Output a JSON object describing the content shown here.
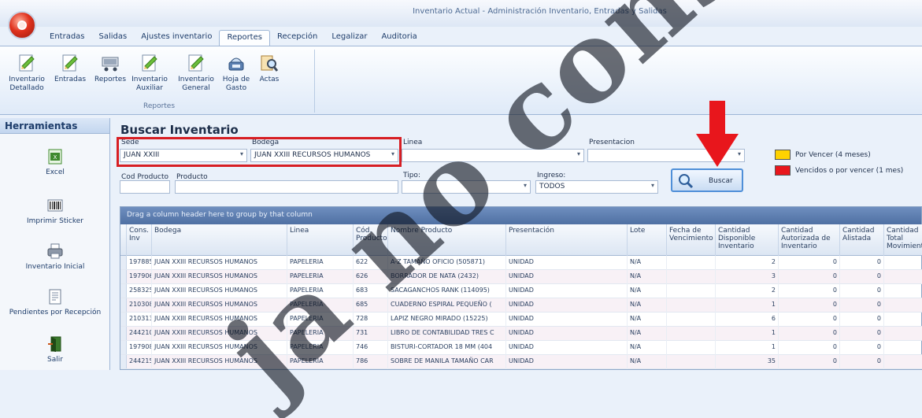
{
  "window": {
    "title": "Inventario Actual - Administración Inventario, Entradas y Salidas"
  },
  "menu": {
    "tabs": [
      "Entradas",
      "Salidas",
      "Ajustes inventario",
      "Reportes",
      "Recepción",
      "Legalizar",
      "Auditoria"
    ],
    "active_tab": "Reportes"
  },
  "ribbon": {
    "group_label": "Reportes",
    "buttons": [
      {
        "label": "Inventario Detallado",
        "icon": "document-pencil-icon"
      },
      {
        "label": "Entradas",
        "icon": "document-pencil-icon"
      },
      {
        "label": "Reportes",
        "icon": "shopping-cart-icon"
      },
      {
        "label": "Inventario Auxiliar",
        "icon": "document-pencil-icon"
      },
      {
        "label": "Inventario General",
        "icon": "document-pencil-icon"
      },
      {
        "label": "Hoja de Gasto",
        "icon": "scale-icon"
      },
      {
        "label": "Actas",
        "icon": "magnifier-document-icon"
      }
    ]
  },
  "sidebar": {
    "header": "Herramientas",
    "items": [
      {
        "label": "Excel",
        "icon": "excel-icon"
      },
      {
        "label": "Imprimir Sticker",
        "icon": "barcode-icon"
      },
      {
        "label": "Inventario Inicial",
        "icon": "printer-icon"
      },
      {
        "label": "Pendientes por Recepción",
        "icon": "document-list-icon"
      },
      {
        "label": "Salir",
        "icon": "exit-door-icon"
      }
    ]
  },
  "search": {
    "title": "Buscar Inventario",
    "sede_label": "Sede",
    "sede_value": "JUAN XXIII",
    "bodega_label": "Bodega",
    "bodega_value": "JUAN XXIII RECURSOS HUMANOS",
    "linea_label": "Linea",
    "linea_value": "",
    "presentacion_label": "Presentacion",
    "presentacion_value": "",
    "cod_producto_label": "Cod Producto",
    "cod_producto_value": "",
    "producto_label": "Producto",
    "producto_value": "",
    "tipo_label": "Tipo:",
    "tipo_value": "",
    "ingreso_label": "Ingreso:",
    "ingreso_value": "TODOS",
    "buscar_label": "Buscar"
  },
  "legend": [
    {
      "label": "Por Vencer (4 meses)",
      "color": "#ffd200"
    },
    {
      "label": "Vencidos o por vencer (1 mes)",
      "color": "#e8161c"
    }
  ],
  "grid": {
    "group_hint": "Drag a column header here to group by that column",
    "columns": [
      "Cons. Inv",
      "Bodega",
      "Linea",
      "Cód. Producto",
      "Nombre Producto",
      "Presentación",
      "Lote",
      "Fecha de Vencimiento",
      "Cantidad Disponible Inventario",
      "Cantidad Autorizada de Inventario",
      "Cantidad Alistada",
      "Cantidad Total Movimiento"
    ],
    "rows": [
      [
        "197885",
        "JUAN XXIII RECURSOS HUMANOS",
        "PAPELERIA",
        "622",
        "A-Z TAMAÑO OFICIO (505871)",
        "UNIDAD",
        "N/A",
        "",
        "2",
        "0",
        "0",
        ""
      ],
      [
        "197906",
        "JUAN XXIII RECURSOS HUMANOS",
        "PAPELERIA",
        "626",
        "BORRADOR DE NATA (2432)",
        "UNIDAD",
        "N/A",
        "",
        "3",
        "0",
        "0",
        ""
      ],
      [
        "258325",
        "JUAN XXIII RECURSOS HUMANOS",
        "PAPELERIA",
        "683",
        "SACAGANCHOS RANK (114095)",
        "UNIDAD",
        "N/A",
        "",
        "2",
        "0",
        "0",
        ""
      ],
      [
        "210308",
        "JUAN XXIII RECURSOS HUMANOS",
        "PAPELERIA",
        "685",
        "CUADERNO ESPIRAL PEQUEÑO (",
        "UNIDAD",
        "N/A",
        "",
        "1",
        "0",
        "0",
        ""
      ],
      [
        "210313",
        "JUAN XXIII RECURSOS HUMANOS",
        "PAPELERIA",
        "728",
        "LAPIZ NEGRO MIRADO (15225)",
        "UNIDAD",
        "N/A",
        "",
        "6",
        "0",
        "0",
        ""
      ],
      [
        "244210",
        "JUAN XXIII RECURSOS HUMANOS",
        "PAPELERIA",
        "731",
        "LIBRO DE CONTABILIDAD TRES C",
        "UNIDAD",
        "N/A",
        "",
        "1",
        "0",
        "0",
        ""
      ],
      [
        "197908",
        "JUAN XXIII RECURSOS HUMANOS",
        "PAPELERIA",
        "746",
        "BISTURI-CORTADOR 18 MM (404",
        "UNIDAD",
        "N/A",
        "",
        "1",
        "0",
        "0",
        ""
      ],
      [
        "244215",
        "JUAN XXIII RECURSOS HUMANOS",
        "PAPELERIA",
        "786",
        "SOBRE DE MANILA TAMAÑO CAR",
        "UNIDAD",
        "N/A",
        "",
        "35",
        "0",
        "0",
        ""
      ]
    ]
  },
  "watermark": "ja no cons",
  "colors": {
    "highlight_red": "#d71e23",
    "arrow_red": "#e8161c",
    "grid_group_bar": "#4f70a3"
  }
}
